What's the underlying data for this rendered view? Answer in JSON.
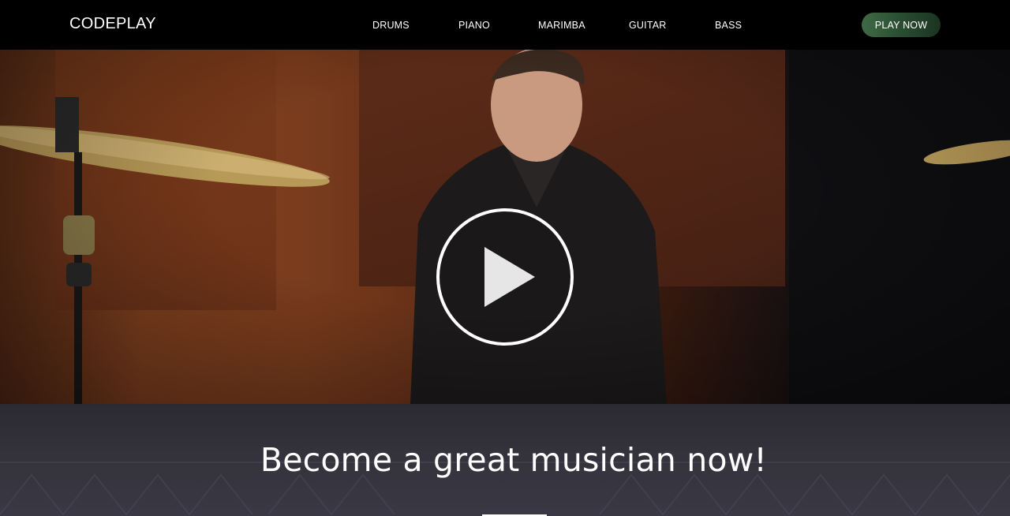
{
  "header": {
    "logo": "CODEPLAY",
    "nav": [
      "DRUMS",
      "PIANO",
      "MARIMBA",
      "GUITAR",
      "BASS"
    ],
    "cta_label": "PLAY NOW"
  },
  "hero": {
    "icons": [
      "play-icon"
    ]
  },
  "section": {
    "headline": "Become a great musician now!"
  },
  "colors": {
    "header_bg": "#000000",
    "cta_gradient_start": "#3f6a45",
    "cta_gradient_end": "#1b3422",
    "section_bg": "#34323b",
    "text": "#ffffff"
  }
}
